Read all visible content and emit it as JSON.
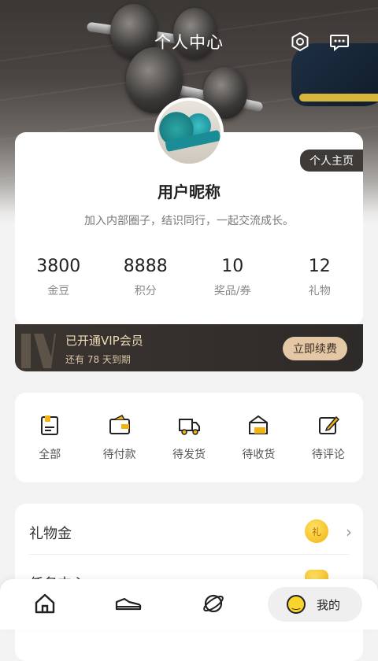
{
  "header": {
    "title": "个人中心",
    "settings_icon": "settings-icon",
    "message_icon": "message-icon"
  },
  "profile": {
    "homepage_tag": "个人主页",
    "nickname": "用户昵称",
    "intro": "加入内部圈子，结识同行，一起交流成长。",
    "stats": [
      {
        "value": "3800",
        "label": "金豆"
      },
      {
        "value": "8888",
        "label": "积分"
      },
      {
        "value": "10",
        "label": "奖品/券"
      },
      {
        "value": "12",
        "label": "礼物"
      }
    ]
  },
  "vip": {
    "title": "已开通VIP会员",
    "subtitle": "还有 78 天到期",
    "renew_label": "立即续费"
  },
  "orders": [
    {
      "label": "全部",
      "icon": "all-orders-icon"
    },
    {
      "label": "待付款",
      "icon": "wallet-icon"
    },
    {
      "label": "待发货",
      "icon": "truck-icon"
    },
    {
      "label": "待收货",
      "icon": "package-icon"
    },
    {
      "label": "待评论",
      "icon": "edit-icon"
    }
  ],
  "menu": [
    {
      "label": "礼物金",
      "badge": "礼"
    },
    {
      "label": "任务中心",
      "badge": ""
    }
  ],
  "tabbar": {
    "active_label": "我的",
    "tabs": [
      "home-icon",
      "shoe-icon",
      "planet-icon",
      "smiley-icon"
    ]
  },
  "colors": {
    "accent_gold": "#e4c7a5",
    "vip_bg": "#2d2a28",
    "coin": "#f2b311"
  }
}
